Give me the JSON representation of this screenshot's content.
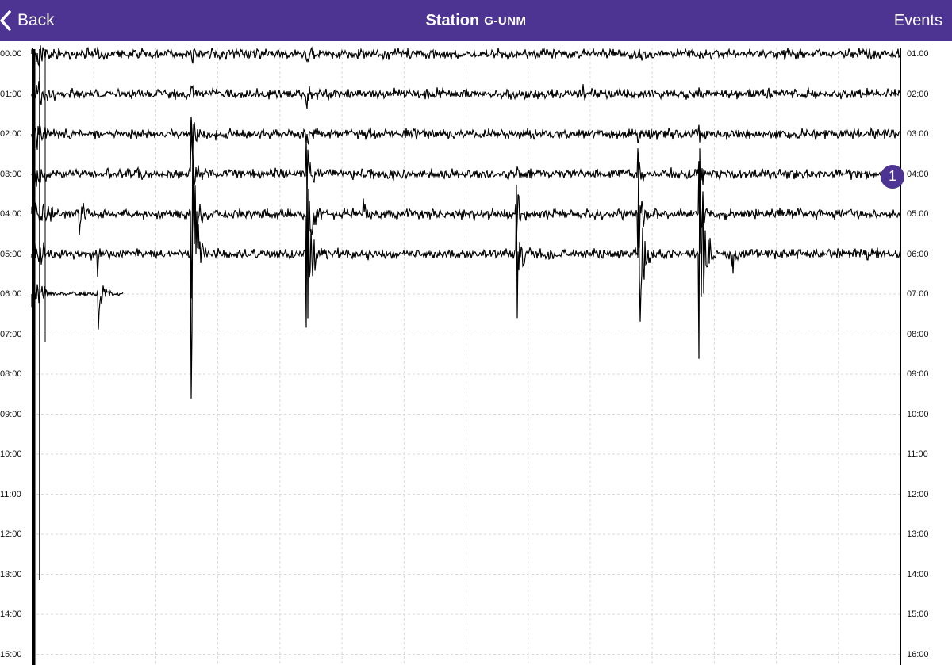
{
  "navbar": {
    "back_label": "Back",
    "title_prefix": "Station",
    "station_code": "G-UNM",
    "events_label": "Events",
    "background_color": "#4d3492",
    "back_icon": "chevron-left-icon"
  },
  "helicorder": {
    "left_time_labels": [
      "00:00",
      "01:00",
      "02:00",
      "03:00",
      "04:00",
      "05:00",
      "06:00",
      "07:00",
      "08:00",
      "09:00",
      "10:00",
      "11:00",
      "12:00",
      "13:00",
      "14:00",
      "15:00"
    ],
    "right_time_labels": [
      "01:00",
      "02:00",
      "03:00",
      "04:00",
      "05:00",
      "06:00",
      "07:00",
      "08:00",
      "09:00",
      "10:00",
      "11:00",
      "12:00",
      "13:00",
      "14:00",
      "15:00",
      "16:00"
    ],
    "active_traces": 7,
    "trace_color": "#000000",
    "grid_color": "#d9d9d9",
    "event_marker": {
      "label": "1",
      "row": 3
    }
  }
}
